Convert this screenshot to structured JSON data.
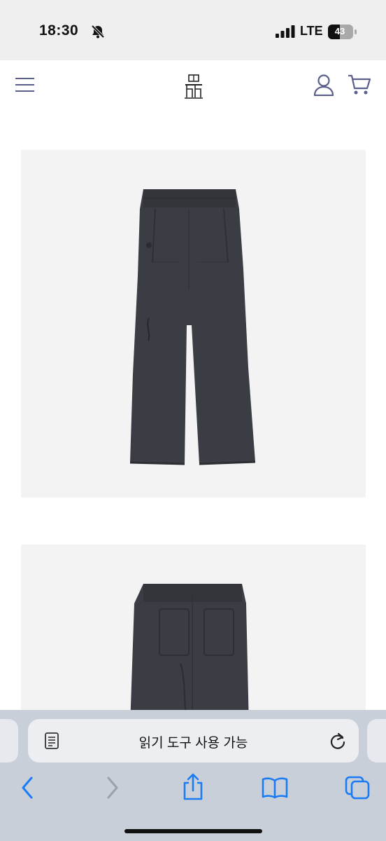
{
  "status_bar": {
    "time": "18:30",
    "network": "LTE",
    "battery": "43",
    "icons": [
      "bell-slash-icon",
      "signal-icon",
      "battery-icon"
    ]
  },
  "header": {
    "icons": [
      "menu-icon",
      "brand-logo",
      "user-icon",
      "cart-icon"
    ],
    "icon_color": "#5a5f8c"
  },
  "product": {
    "images": [
      {
        "view": "front",
        "item": "charcoal wide-leg pants"
      },
      {
        "view": "back",
        "item": "charcoal wide-leg pants"
      }
    ],
    "garment_color": "#3b3d44"
  },
  "browser": {
    "reader_text": "읽기 도구 사용 가능",
    "toolbar_icons": [
      "back-icon",
      "forward-icon",
      "share-icon",
      "bookmarks-icon",
      "tabs-icon"
    ],
    "accent": "#1a7cf5"
  }
}
